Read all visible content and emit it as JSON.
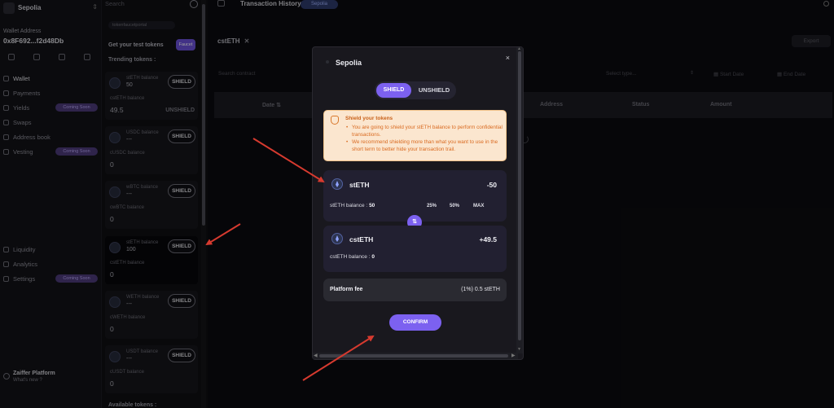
{
  "sidebar": {
    "network": "Sepolia",
    "wallet_label": "Wallet Address",
    "wallet_address": "0x8F692...f2d48Db",
    "nav": [
      {
        "label": "Wallet"
      },
      {
        "label": "Payments"
      },
      {
        "label": "Yields",
        "badge": "Coming Soon"
      },
      {
        "label": "Swaps"
      },
      {
        "label": "Address book"
      },
      {
        "label": "Vesting",
        "badge": "Coming Soon"
      },
      {
        "label": "Liquidity"
      },
      {
        "label": "Analytics"
      },
      {
        "label": "Settings",
        "badge": "Coming Soon"
      }
    ],
    "platform_name": "Zaiffer Platform",
    "platform_sub": "What's new ?"
  },
  "tokens_panel": {
    "search_placeholder": "Search",
    "link_text": "tokenfaucetportal",
    "get_test_tokens": "Get your test tokens",
    "faucet_button": "Faucet",
    "trending_label": "Trending tokens :",
    "available_label": "Available tokens :",
    "cards": [
      {
        "balance_label": "stETH balance",
        "balance": "50",
        "action": "SHIELD",
        "c_label": "cstETH balance",
        "c_value": "49.5",
        "secondary": "UNSHIELD"
      },
      {
        "balance_label": "USDC balance",
        "balance": "---",
        "action": "SHIELD",
        "c_label": "cUSDC balance",
        "c_value": "0"
      },
      {
        "balance_label": "wBTC balance",
        "balance": "---",
        "action": "SHIELD",
        "c_label": "cwBTC balance",
        "c_value": "0"
      },
      {
        "balance_label": "stETH balance",
        "balance": "100",
        "action": "SHIELD",
        "c_label": "cstETH balance",
        "c_value": "0"
      },
      {
        "balance_label": "WETH balance",
        "balance": "---",
        "action": "SHIELD",
        "c_label": "cWETH balance",
        "c_value": "0"
      },
      {
        "balance_label": "USDT balance",
        "balance": "---",
        "action": "SHIELD",
        "c_label": "cUSDT balance",
        "c_value": "0"
      }
    ]
  },
  "main": {
    "title": "Transaction History",
    "title_badge": "Sepolia",
    "filter_chip": "cstETH",
    "export_label": "Export",
    "search_placeholder": "Search contract",
    "select_type_placeholder": "Select type...",
    "start_date": "Start Date",
    "end_date": "End Date",
    "columns": [
      "Date",
      "Address",
      "Status",
      "Amount"
    ]
  },
  "modal": {
    "network": "Sepolia",
    "close_symbol": "×",
    "tab_shield": "SHIELD",
    "tab_unshield": "UNSHIELD",
    "warning": {
      "title": "Shield your tokens",
      "items": [
        "You are going to shield your stETH balance to perform confidential transactions.",
        "We recommend shielding more than what you want to use in the short term to better hide your transaction trail."
      ]
    },
    "from": {
      "token": "stETH",
      "amount": "-50",
      "balance_label": "stETH balance :",
      "balance_value": "50",
      "presets": [
        "25%",
        "50%",
        "MAX"
      ]
    },
    "to": {
      "token": "cstETH",
      "amount": "+49.5",
      "balance_label": "cstETH balance :",
      "balance_value": "0"
    },
    "swap_symbol": "⇅",
    "fee_label": "Platform fee",
    "fee_value": "(1%) 0.5 stETH",
    "confirm_label": "CONFIRM"
  },
  "colors": {
    "accent": "#7c61f0",
    "warning_bg": "#fbe6cf",
    "warning_text": "#d96a20",
    "annotation_arrow": "#d63a2f"
  }
}
